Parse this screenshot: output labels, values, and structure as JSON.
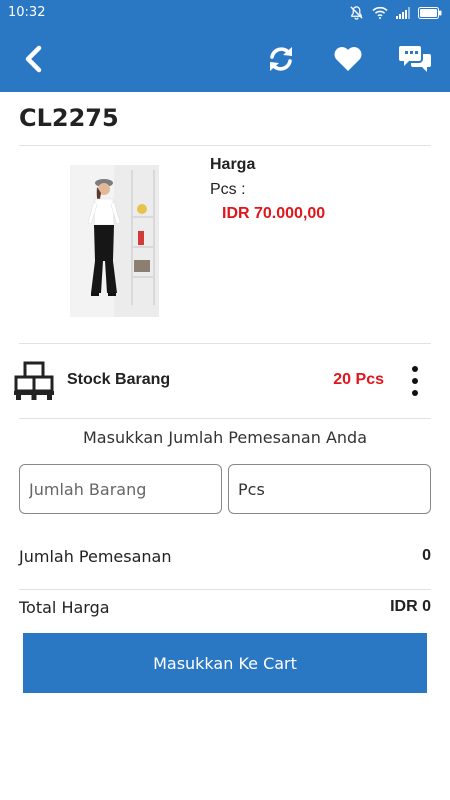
{
  "status_bar": {
    "time": "10:32",
    "icons": [
      "mute-icon",
      "wifi-icon",
      "signal-icon",
      "battery-icon"
    ]
  },
  "app_bar": {
    "color": "#2a78c4",
    "icons": [
      "back-icon",
      "refresh-icon",
      "heart-icon",
      "chat-icon"
    ]
  },
  "product": {
    "code": "CL2275",
    "price_label": "Harga",
    "unit_label": "Pcs :",
    "price": "IDR 70.000,00"
  },
  "stock": {
    "label": "Stock Barang",
    "value": "20 Pcs",
    "icon": "pallet-boxes-icon"
  },
  "order": {
    "prompt": "Masukkan Jumlah Pemesanan Anda",
    "quantity_placeholder": "Jumlah Barang",
    "unit_value": "Pcs",
    "quantity_label": "Jumlah Pemesanan",
    "quantity_value": "0",
    "total_label": "Total Harga",
    "total_value": "IDR 0"
  },
  "cart_button": {
    "label": "Masukkan Ke Cart"
  },
  "colors": {
    "primary": "#2a78c4",
    "accent_red": "#e0161c"
  }
}
